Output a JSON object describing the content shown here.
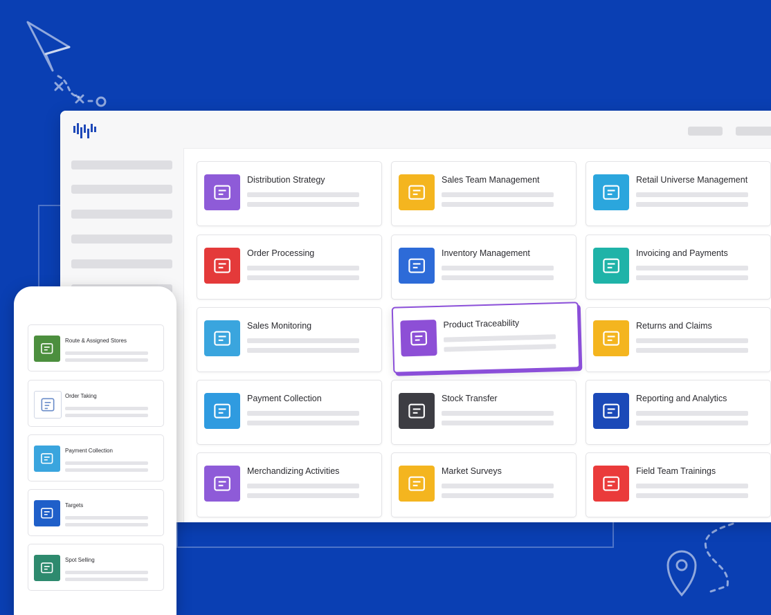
{
  "desktop": {
    "modules": [
      {
        "title": "Distribution Strategy",
        "icon": "network-hub-icon",
        "color": "#8e5bd8"
      },
      {
        "title": "Sales Team Management",
        "icon": "team-growth-chart-icon",
        "color": "#f4b51f"
      },
      {
        "title": "Retail Universe Management",
        "icon": "storefront-icon",
        "color": "#2ba6dd"
      },
      {
        "title": "Order Processing",
        "icon": "order-timer-icon",
        "color": "#e43a3a"
      },
      {
        "title": "Inventory Management",
        "icon": "clipboard-boxes-icon",
        "color": "#2d6bd8"
      },
      {
        "title": "Invoicing and Payments",
        "icon": "invoice-screen-icon",
        "color": "#1fb3a8"
      },
      {
        "title": "Sales Monitoring",
        "icon": "sales-trend-icon",
        "color": "#3aa5de"
      },
      {
        "title": "Product Traceability",
        "icon": "location-globe-icon",
        "color": "#8d4fd6"
      },
      {
        "title": "Returns and Claims",
        "icon": "returns-receipt-icon",
        "color": "#f4b51f"
      },
      {
        "title": "Payment Collection",
        "icon": "cash-collection-icon",
        "color": "#2f9be0"
      },
      {
        "title": "Stock Transfer",
        "icon": "stock-transfer-icon",
        "color": "#3d3d43"
      },
      {
        "title": "Reporting and Analytics",
        "icon": "analytics-report-icon",
        "color": "#1b49b8"
      },
      {
        "title": "Merchandizing Activities",
        "icon": "merchandising-shelf-icon",
        "color": "#8e5bd8"
      },
      {
        "title": "Market Surveys",
        "icon": "survey-checklist-icon",
        "color": "#f4b51f"
      },
      {
        "title": "Field Team Trainings",
        "icon": "training-session-icon",
        "color": "#ea3b3b"
      }
    ]
  },
  "mobile": {
    "items": [
      {
        "label": "Route & Assigned Stores",
        "icon": "route-map-icon",
        "color": "#4c8f3e"
      },
      {
        "label": "Order Taking",
        "icon": "order-form-icon",
        "color": "#ffffff"
      },
      {
        "label": "Payment Collection",
        "icon": "payment-collection-icon",
        "color": "#3aa5de"
      },
      {
        "label": "Targets",
        "icon": "target-icon",
        "color": "#1f5fc9"
      },
      {
        "label": "Spot Selling",
        "icon": "spot-selling-icon",
        "color": "#2e8a6e"
      }
    ]
  }
}
